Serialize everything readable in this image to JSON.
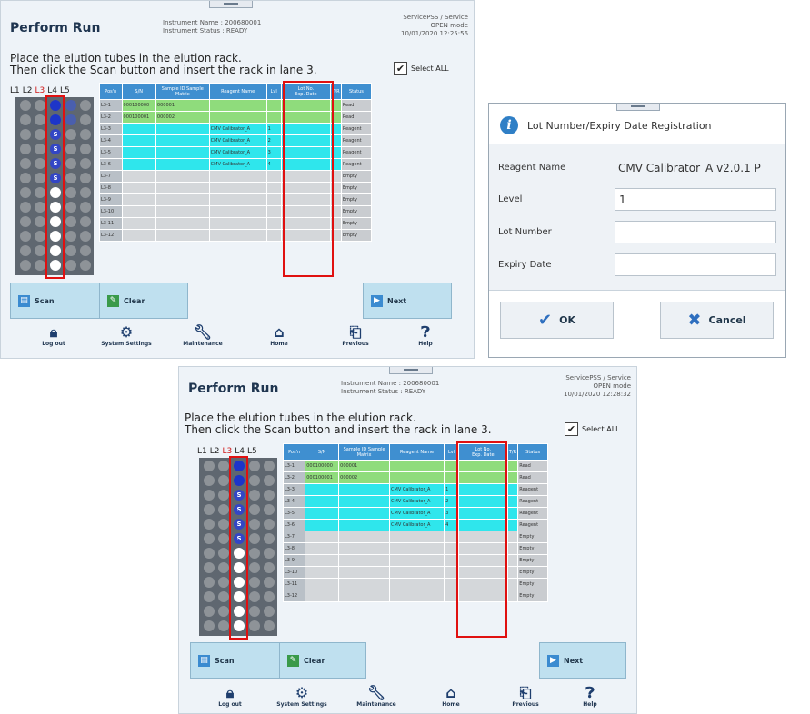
{
  "screen1": {
    "title": "Perform Run",
    "instrument_name": "Instrument Name : 200680001",
    "instrument_status": "Instrument Status : READY",
    "user": "ServicePSS / Service",
    "mode": "OPEN mode",
    "datetime": "10/01/2020 12:25:56",
    "instruction_line1": "Place the elution tubes in the elution rack.",
    "instruction_line2": "Then click the Scan button and insert the rack in lane 3.",
    "select_all": "Select ALL",
    "lot_column": {
      "lot": "Lot No.",
      "exp": "Exp. Date"
    },
    "rows": [
      {
        "pos": "L3-1",
        "sn": "000100000",
        "sample": "000001",
        "reagent": "",
        "lvl": "",
        "lot": "",
        "st": "Read"
      },
      {
        "pos": "L3-2",
        "sn": "000100001",
        "sample": "000002",
        "reagent": "",
        "lvl": "",
        "lot": "",
        "st": "Read"
      },
      {
        "pos": "L3-3",
        "sn": "",
        "sample": "",
        "reagent": "CMV Calibrator_A",
        "lvl": "1",
        "lot": "",
        "st": "Reagent"
      },
      {
        "pos": "L3-4",
        "sn": "",
        "sample": "",
        "reagent": "CMV Calibrator_A",
        "lvl": "2",
        "lot": "",
        "st": "Reagent"
      },
      {
        "pos": "L3-5",
        "sn": "",
        "sample": "",
        "reagent": "CMV Calibrator_A",
        "lvl": "3",
        "lot": "",
        "st": "Reagent"
      },
      {
        "pos": "L3-6",
        "sn": "",
        "sample": "",
        "reagent": "CMV Calibrator_A",
        "lvl": "4",
        "lot": "",
        "st": "Reagent"
      },
      {
        "pos": "L3-7",
        "sn": "",
        "sample": "",
        "reagent": "",
        "lvl": "",
        "lot": "",
        "st": "Empty"
      },
      {
        "pos": "L3-8",
        "sn": "",
        "sample": "",
        "reagent": "",
        "lvl": "",
        "lot": "",
        "st": "Empty"
      },
      {
        "pos": "L3-9",
        "sn": "",
        "sample": "",
        "reagent": "",
        "lvl": "",
        "lot": "",
        "st": "Empty"
      },
      {
        "pos": "L3-10",
        "sn": "",
        "sample": "",
        "reagent": "",
        "lvl": "",
        "lot": "",
        "st": "Empty"
      },
      {
        "pos": "L3-11",
        "sn": "",
        "sample": "",
        "reagent": "",
        "lvl": "",
        "lot": "",
        "st": "Empty"
      },
      {
        "pos": "L3-12",
        "sn": "",
        "sample": "",
        "reagent": "",
        "lvl": "",
        "lot": "",
        "st": "Empty"
      }
    ]
  },
  "screen2": {
    "title": "Perform Run",
    "instrument_name": "Instrument Name : 200680001",
    "instrument_status": "Instrument Status : READY",
    "user": "ServicePSS / Service",
    "mode": "OPEN mode",
    "datetime": "10/01/2020 12:28:32",
    "instruction_line1": "Place the elution tubes in the elution rack.",
    "instruction_line2": "Then click the Scan button and insert the rack in lane 3.",
    "select_all": "Select ALL",
    "lot_column": {
      "lot": "Lot No.",
      "exp": "Exp. Date"
    },
    "rows": [
      {
        "pos": "L3-1",
        "sn": "000100000",
        "sample": "000001",
        "reagent": "",
        "lvl": "",
        "lot": "",
        "st": "Read"
      },
      {
        "pos": "L3-2",
        "sn": "000100001",
        "sample": "000002",
        "reagent": "",
        "lvl": "",
        "lot": "",
        "st": "Read"
      },
      {
        "pos": "L3-3",
        "sn": "",
        "sample": "",
        "reagent": "CMV Calibrator_A",
        "lvl": "1",
        "lot": "",
        "st": "Reagent"
      },
      {
        "pos": "L3-4",
        "sn": "",
        "sample": "",
        "reagent": "CMV Calibrator_A",
        "lvl": "2",
        "lot": "",
        "st": "Reagent"
      },
      {
        "pos": "L3-5",
        "sn": "",
        "sample": "",
        "reagent": "CMV Calibrator_A",
        "lvl": "3",
        "lot": "",
        "st": "Reagent"
      },
      {
        "pos": "L3-6",
        "sn": "",
        "sample": "",
        "reagent": "CMV Calibrator_A",
        "lvl": "4",
        "lot": "",
        "st": "Reagent"
      },
      {
        "pos": "L3-7",
        "sn": "",
        "sample": "",
        "reagent": "",
        "lvl": "",
        "lot": "",
        "st": "Empty"
      },
      {
        "pos": "L3-8",
        "sn": "",
        "sample": "",
        "reagent": "",
        "lvl": "",
        "lot": "",
        "st": "Empty"
      },
      {
        "pos": "L3-9",
        "sn": "",
        "sample": "",
        "reagent": "",
        "lvl": "",
        "lot": "",
        "st": "Empty"
      },
      {
        "pos": "L3-10",
        "sn": "",
        "sample": "",
        "reagent": "",
        "lvl": "",
        "lot": "",
        "st": "Empty"
      },
      {
        "pos": "L3-11",
        "sn": "",
        "sample": "",
        "reagent": "",
        "lvl": "",
        "lot": "",
        "st": "Empty"
      },
      {
        "pos": "L3-12",
        "sn": "",
        "sample": "",
        "reagent": "",
        "lvl": "",
        "lot": "",
        "st": "Empty"
      }
    ]
  },
  "table_headers": {
    "pos": "Pos'n",
    "sn": "S/N",
    "sample": "Sample ID Sample Matrix",
    "reagent": "Reagent Name",
    "lvl": "Lvl",
    "tr": "T/R",
    "status": "Status"
  },
  "lanes": [
    "L1",
    "L2",
    "L3",
    "L4",
    "L5"
  ],
  "buttons": {
    "scan": "Scan",
    "clear": "Clear",
    "next": "Next"
  },
  "footer": {
    "logout": "Log out",
    "settings": "System Settings",
    "maintenance": "Maintenance",
    "home": "Home",
    "previous": "Previous",
    "help": "Help"
  },
  "dialog": {
    "title": "Lot Number/Expiry Date Registration",
    "reagent_label": "Reagent Name",
    "reagent_value": "CMV Calibrator_A v2.0.1 P",
    "level_label": "Level",
    "level_value": "1",
    "lot_label": "Lot Number",
    "lot_value": "",
    "expiry_label": "Expiry Date",
    "expiry_value": "",
    "ok": "OK",
    "cancel": "Cancel"
  },
  "colors": {
    "accent": "#3f8fd0",
    "read_row": "#8fdc7c",
    "reagent_row": "#2fe6ec",
    "empty_row": "#d4d7da",
    "highlight": "#e01010"
  }
}
